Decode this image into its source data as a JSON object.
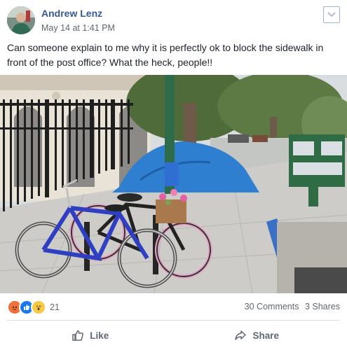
{
  "post": {
    "author": "Andrew Lenz",
    "timestamp": "May 14 at 1:41 PM",
    "text": "Can someone explain to me why it is perfectly ok to block the sidewalk in front of the post office? What the heck, people!!"
  },
  "stats": {
    "reaction_icons": [
      "angry-icon",
      "like-icon",
      "wow-icon"
    ],
    "reaction_count": "21",
    "comments": "30 Comments",
    "shares": "3 Shares"
  },
  "actions": {
    "like_label": "Like",
    "share_label": "Share"
  },
  "colors": {
    "author_link": "#365899",
    "like_blue": "#1877f2",
    "angry_orange": "#f0703a",
    "wow_yellow": "#f7c945"
  }
}
